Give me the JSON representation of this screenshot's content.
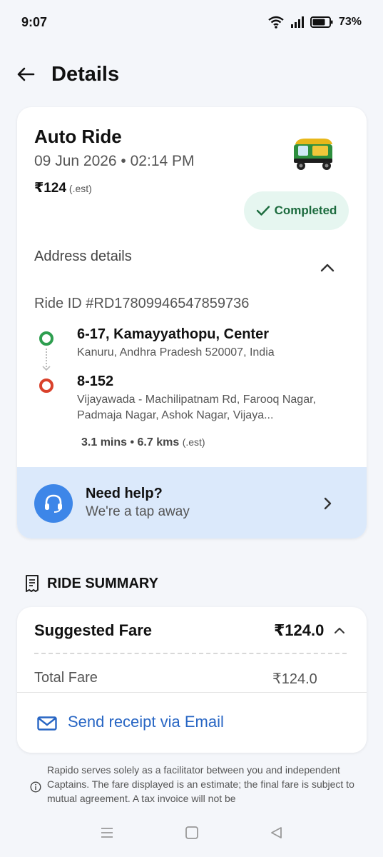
{
  "status_bar": {
    "time": "9:07",
    "battery": "73%"
  },
  "header": {
    "title": "Details"
  },
  "ride": {
    "title": "Auto Ride",
    "date": "09 Jun 2026 • 02:14 PM",
    "price": "₹124",
    "price_note": "(.est)",
    "status": "Completed",
    "address_heading": "Address details",
    "ride_id": "Ride ID #RD17809946547859736",
    "pickup": {
      "title": "6-17, Kamayyathopu, Center",
      "address": "Kanuru, Andhra Pradesh 520007, India"
    },
    "drop": {
      "title": "8-152",
      "address": "Vijayawada - Machilipatnam Rd, Farooq Nagar, Padmaja Nagar, Ashok Nagar, Vijaya..."
    },
    "trip_meta": "3.1 mins • 6.7 kms",
    "trip_meta_note": "(.est)"
  },
  "help": {
    "title": "Need help?",
    "subtitle": "We're a tap away"
  },
  "summary": {
    "heading": "RIDE SUMMARY",
    "suggested_fare_label": "Suggested Fare",
    "suggested_fare_value": "₹124.0",
    "total_fare_label": "Total Fare",
    "total_fare_value": "₹124.0",
    "receipt_label": "Send receipt via Email"
  },
  "disclaimer": "Rapido serves solely as a facilitator between you and independent Captains. The fare displayed is an estimate; the final fare is subject to mutual agreement. A tax invoice will not be",
  "colors": {
    "completed_green": "#1c6b3e",
    "link_blue": "#2866c4",
    "help_bg": "#dbe9fb",
    "pickup": "#2e9e4f",
    "drop": "#d9412b"
  }
}
